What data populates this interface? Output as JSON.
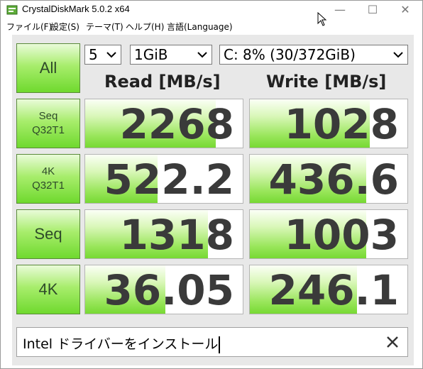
{
  "window": {
    "title": "CrystalDiskMark 5.0.2 x64",
    "minimize": "—",
    "maximize": "☐",
    "close": "✕"
  },
  "menu": [
    "ファイル(F)",
    "設定(S)",
    "テーマ(T)",
    "ヘルプ(H)",
    "言語(Language)"
  ],
  "controls": {
    "all_label": "All",
    "count": "5",
    "size": "1GiB",
    "drive": "C: 8% (30/372GiB)"
  },
  "headers": {
    "read": "Read [MB/s]",
    "write": "Write [MB/s]"
  },
  "tests": [
    {
      "line1": "Seq",
      "line2": "Q32T1",
      "read": "2268",
      "write": "1028",
      "read_fill": 0.83,
      "write_fill": 0.76
    },
    {
      "line1": "4K",
      "line2": "Q32T1",
      "read": "522.2",
      "write": "436.6",
      "read_fill": 0.46,
      "write_fill": 0.74
    },
    {
      "line1": "Seq",
      "line2": "",
      "read": "1318",
      "write": "1003",
      "read_fill": 0.78,
      "write_fill": 0.74
    },
    {
      "line1": "4K",
      "line2": "",
      "read": "36.05",
      "write": "246.1",
      "read_fill": 0.51,
      "write_fill": 0.68
    }
  ],
  "comment": {
    "text": "Intel ドライバーをインストール"
  },
  "colors": {
    "button_green": "#6fd92e",
    "bar_green": "#77d933",
    "text_dark": "#3a3a3a"
  }
}
